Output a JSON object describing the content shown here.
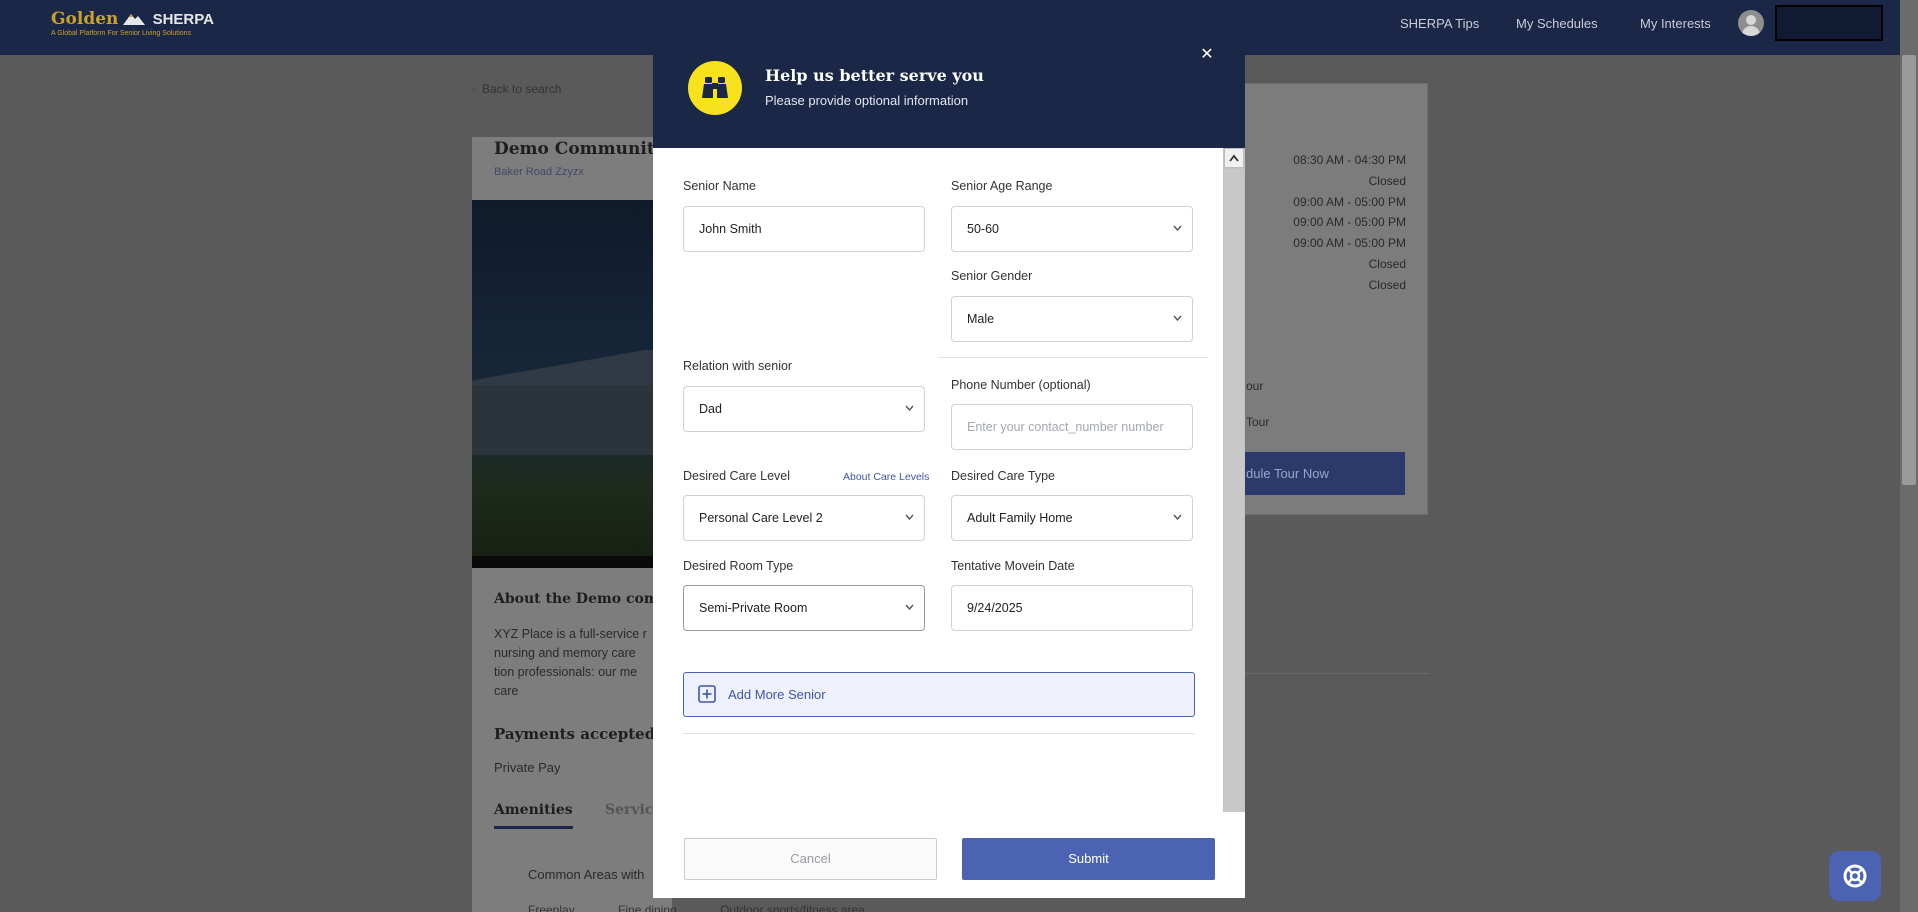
{
  "nav": {
    "brand_golden": "Golden",
    "brand_sherpa": "SHERPA",
    "brand_tagline": "A Global Platform For Senior Living Solutions",
    "links": [
      "SHERPA Tips",
      "My Schedules",
      "My Interests"
    ]
  },
  "background": {
    "back_link": "Back to search",
    "community_title": "Demo Community",
    "community_address": "Baker Road Zzyzx",
    "about_title": "About the Demo comm",
    "about_lines": [
      "XYZ Place is a full-service r",
      "nursing and memory care",
      "tion professionals: our me",
      "care"
    ],
    "payments_title": "Payments accepted",
    "payments_value": "Private Pay",
    "tabs": [
      "Amenities",
      "Servic"
    ],
    "amenity_row": "Common Areas with",
    "amenity_bottom": [
      "Freeplay",
      "Fine dining",
      "Outdoor sports/fitness area"
    ],
    "hours": [
      "08:30 AM - 04:30 PM",
      "Closed",
      "09:00 AM - 05:00 PM",
      "09:00 AM - 05:00 PM",
      "09:00 AM - 05:00 PM",
      "Closed",
      "Closed"
    ],
    "tour_options": [
      "our",
      "Tour"
    ],
    "tour_button": "dule Tour Now"
  },
  "modal": {
    "title": "Help us better serve you",
    "subtitle": "Please provide optional information",
    "fields": {
      "senior_name": {
        "label": "Senior Name",
        "value": "John Smith"
      },
      "senior_age_range": {
        "label": "Senior Age Range",
        "value": "50-60"
      },
      "senior_gender": {
        "label": "Senior Gender",
        "value": "Male"
      },
      "relation": {
        "label": "Relation with senior",
        "value": "Dad"
      },
      "phone": {
        "label": "Phone Number (optional)",
        "placeholder": "Enter your contact_number number"
      },
      "care_level": {
        "label": "Desired Care Level",
        "value": "Personal Care Level 2",
        "link": "About Care Levels"
      },
      "care_type": {
        "label": "Desired Care Type",
        "value": "Adult Family Home"
      },
      "room_type": {
        "label": "Desired Room Type",
        "value": "Semi-Private Room"
      },
      "movein_date": {
        "label": "Tentative Movein Date",
        "value": "9/24/2025"
      }
    },
    "add_more": "Add More Senior",
    "cancel": "Cancel",
    "submit": "Submit"
  },
  "colors": {
    "nav_bg": "#1b2747",
    "accent": "#4c63b3",
    "icon_yellow": "#f7e21d"
  },
  "icons": {
    "modal_icon": "binoculars-icon",
    "close": "close-icon",
    "add": "plus-square-icon",
    "help": "lifebuoy-icon"
  }
}
